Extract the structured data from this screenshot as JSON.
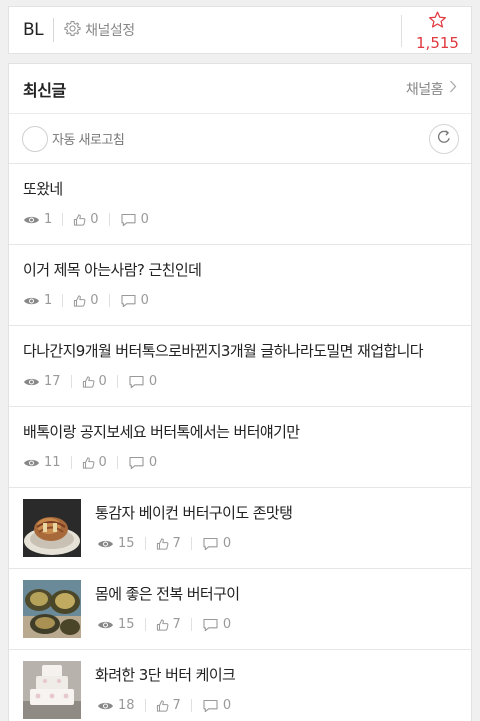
{
  "header": {
    "channel_name": "BL",
    "settings_label": "채널설정",
    "subscriber_count": "1,515"
  },
  "panel": {
    "title": "최신글",
    "home_label": "채널홈",
    "auto_refresh_label": "자동 새로고침"
  },
  "posts": [
    {
      "title": "또왔네",
      "views": "1",
      "likes": "0",
      "comments": "0",
      "thumbnail": null
    },
    {
      "title": "이거 제목 아는사람? 근친인데",
      "views": "1",
      "likes": "0",
      "comments": "0",
      "thumbnail": null
    },
    {
      "title": "다나간지9개월 버터톡으로바뀐지3개월 글하나라도밀면 재업합니다",
      "views": "17",
      "likes": "0",
      "comments": "0",
      "thumbnail": null
    },
    {
      "title": "배톡이랑 공지보세요 버터톡에서는 버터얘기만",
      "views": "11",
      "likes": "0",
      "comments": "0",
      "thumbnail": null
    },
    {
      "title": "통감자 베이컨 버터구이도 존맛탱",
      "views": "15",
      "likes": "7",
      "comments": "0",
      "thumbnail": "potato-bacon-photo"
    },
    {
      "title": "몸에 좋은 전복 버터구이",
      "views": "15",
      "likes": "7",
      "comments": "0",
      "thumbnail": "abalone-photo"
    },
    {
      "title": "화려한 3단 버터 케이크",
      "views": "18",
      "likes": "7",
      "comments": "0",
      "thumbnail": "cake-photo"
    }
  ],
  "icons": {
    "settings": "gear-icon",
    "subscribe": "star-icon",
    "home": "chevron-right-icon",
    "refresh": "refresh-icon",
    "views": "eye-icon",
    "likes": "thumbs-up-icon",
    "comments": "comment-icon"
  },
  "colors": {
    "accent_red": "#e0393e",
    "muted_text": "#999999",
    "background": "#f0f0f0"
  }
}
